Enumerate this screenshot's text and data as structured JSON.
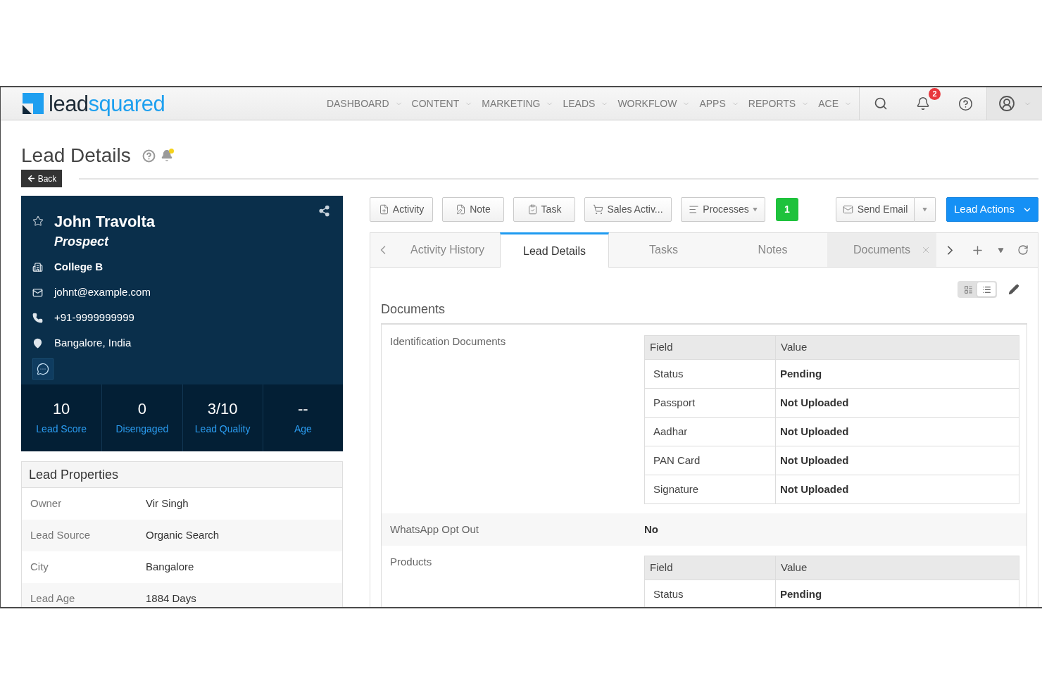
{
  "navbar": {
    "logo": {
      "first_part": "lead",
      "second_part": "squared"
    },
    "menu": [
      "DASHBOARD",
      "CONTENT",
      "MARKETING",
      "LEADS",
      "WORKFLOW",
      "APPS",
      "REPORTS",
      "ACE"
    ],
    "notification_count": "2"
  },
  "page": {
    "title": "Lead Details",
    "back_button": "Back"
  },
  "lead_card": {
    "name": "John Travolta",
    "stage": "Prospect",
    "details": [
      {
        "kind": "company",
        "text": "College B"
      },
      {
        "kind": "email",
        "text": "johnt@example.com"
      },
      {
        "kind": "phone",
        "text": "+91-9999999999"
      },
      {
        "kind": "location",
        "text": "Bangalore, India"
      }
    ],
    "stats": [
      {
        "value": "10",
        "label": "Lead Score"
      },
      {
        "value": "0",
        "label": "Disengaged"
      },
      {
        "value": "3/10",
        "label": "Lead Quality"
      },
      {
        "value": "--",
        "label": "Age"
      }
    ]
  },
  "lead_properties": {
    "title": "Lead Properties",
    "rows": [
      {
        "label": "Owner",
        "value": "Vir Singh"
      },
      {
        "label": "Lead Source",
        "value": "Organic Search"
      },
      {
        "label": "City",
        "value": "Bangalore"
      },
      {
        "label": "Lead Age",
        "value": "1884 Days"
      }
    ]
  },
  "toolbar": {
    "buttons": [
      {
        "kind": "activity",
        "label": "Activity",
        "dropdown": false
      },
      {
        "kind": "note",
        "label": "Note",
        "dropdown": false
      },
      {
        "kind": "task",
        "label": "Task",
        "dropdown": false
      },
      {
        "kind": "sales",
        "label": "Sales Activ...",
        "dropdown": false
      },
      {
        "kind": "processes",
        "label": "Processes",
        "dropdown": true
      }
    ],
    "count_badge": "1",
    "actions": [
      {
        "kind": "split",
        "label": "Send Email"
      },
      {
        "kind": "primary",
        "label": "Lead Actions"
      }
    ]
  },
  "tabs": [
    {
      "label": "Activity History",
      "selected": false,
      "closable": false
    },
    {
      "label": "Lead Details",
      "selected": true,
      "closable": false
    },
    {
      "label": "Tasks",
      "selected": false,
      "closable": false
    },
    {
      "label": "Notes",
      "selected": false,
      "closable": false
    },
    {
      "label": "Documents",
      "selected": false,
      "closable": true
    }
  ],
  "view_toggle": [
    {
      "kind": "detail",
      "selected": false
    },
    {
      "kind": "list",
      "selected": true
    }
  ],
  "documents": {
    "title": "Documents",
    "sections": [
      {
        "kind": "table",
        "label": "Identification Documents",
        "columns": [
          "Field",
          "Value"
        ],
        "rows": [
          [
            "Status",
            "Pending"
          ],
          [
            "Passport",
            "Not Uploaded"
          ],
          [
            "Aadhar",
            "Not Uploaded"
          ],
          [
            "PAN Card",
            "Not Uploaded"
          ],
          [
            "Signature",
            "Not Uploaded"
          ]
        ]
      },
      {
        "kind": "value",
        "label": "WhatsApp Opt Out",
        "value": "No"
      },
      {
        "kind": "table",
        "label": "Products",
        "columns": [
          "Field",
          "Value"
        ],
        "rows": [
          [
            "Status",
            "Pending"
          ]
        ]
      }
    ]
  }
}
